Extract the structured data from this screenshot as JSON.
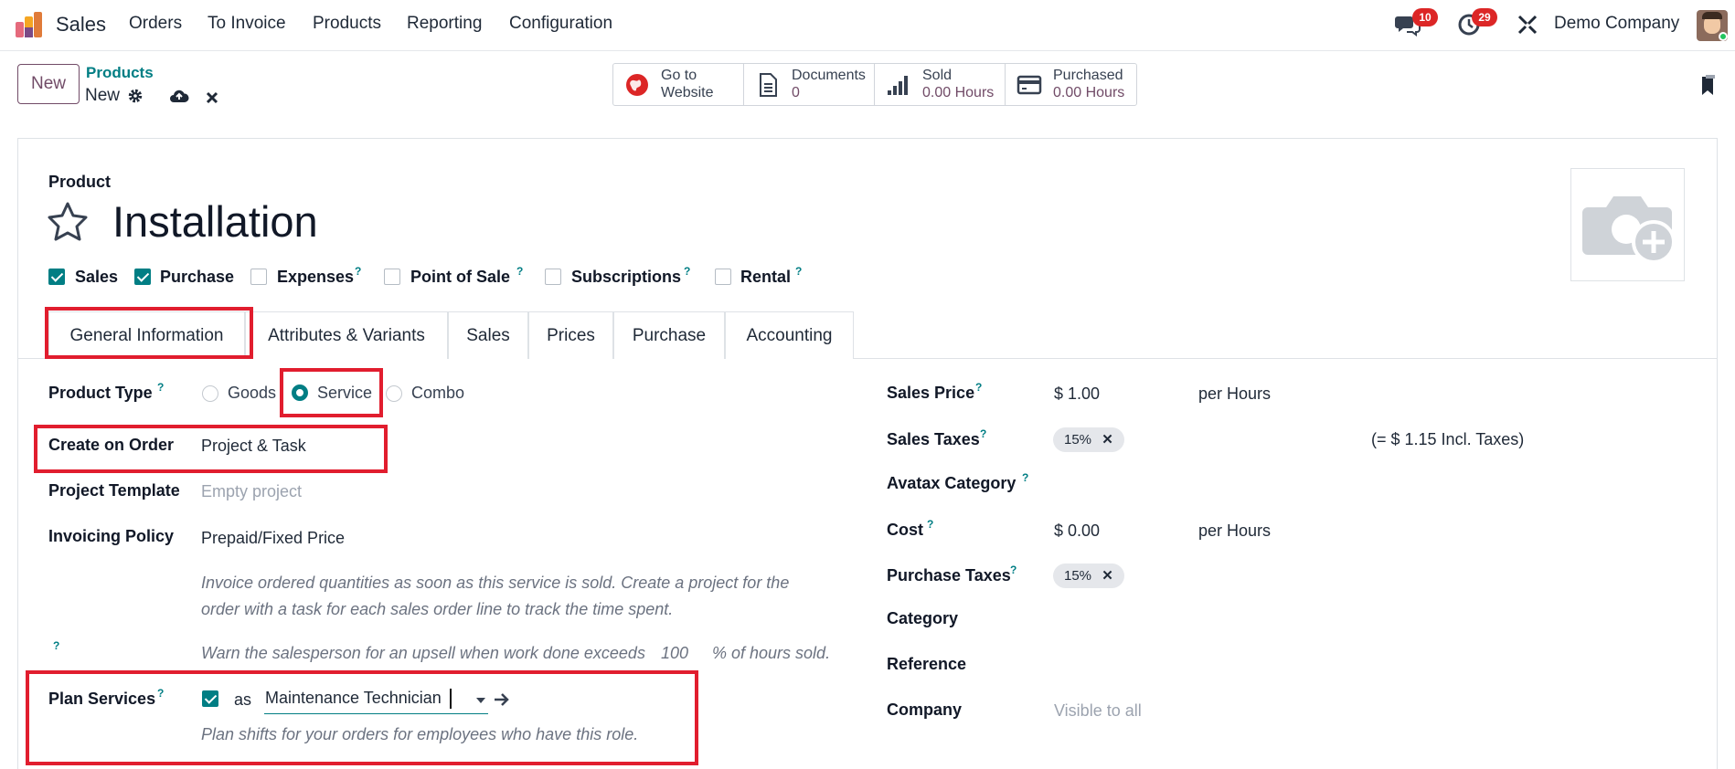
{
  "navbar": {
    "app_name": "Sales",
    "menu": [
      "Orders",
      "To Invoice",
      "Products",
      "Reporting",
      "Configuration"
    ],
    "messages_count": "10",
    "activities_count": "29",
    "company": "Demo Company"
  },
  "control": {
    "new_label": "New",
    "breadcrumb_parent": "Products",
    "breadcrumb_current": "New"
  },
  "smart_buttons": [
    {
      "line1": "Go to",
      "line2": "Website",
      "icon": "globe-icon"
    },
    {
      "line1": "Documents",
      "line2": "0",
      "icon": "document-icon"
    },
    {
      "line1": "Sold",
      "line2": "0.00 Hours",
      "icon": "signal-icon"
    },
    {
      "line1": "Purchased",
      "line2": "0.00 Hours",
      "icon": "credit-card-icon"
    }
  ],
  "product": {
    "header_label": "Product",
    "name": "Installation",
    "flags": [
      {
        "label": "Sales",
        "checked": true,
        "help": false
      },
      {
        "label": "Purchase",
        "checked": true,
        "help": false
      },
      {
        "label": "Expenses",
        "checked": false,
        "help": true
      },
      {
        "label": "Point of Sale",
        "checked": false,
        "help": true
      },
      {
        "label": "Subscriptions",
        "checked": false,
        "help": true
      },
      {
        "label": "Rental",
        "checked": false,
        "help": true
      }
    ]
  },
  "tabs": [
    "General Information",
    "Attributes & Variants",
    "Sales",
    "Prices",
    "Purchase",
    "Accounting"
  ],
  "left": {
    "product_type_label": "Product Type",
    "product_type_options": [
      "Goods",
      "Service",
      "Combo"
    ],
    "product_type_selected": "Service",
    "create_on_order_label": "Create on Order",
    "create_on_order_value": "Project & Task",
    "project_template_label": "Project Template",
    "project_template_placeholder": "Empty project",
    "invoicing_policy_label": "Invoicing Policy",
    "invoicing_policy_value": "Prepaid/Fixed Price",
    "invoicing_note_line1": "Invoice ordered quantities as soon as this service is sold. Create a project for the",
    "invoicing_note_line2": "order with a task for each sales order line to track the time spent.",
    "upsell_before": "Warn the salesperson for an upsell when work done exceeds",
    "upsell_value": "100",
    "upsell_after": "% of hours sold.",
    "plan_services_label": "Plan Services",
    "plan_services_checked": true,
    "plan_as": "as",
    "plan_role": "Maintenance Technician",
    "plan_note": "Plan shifts for your orders for employees who have this role."
  },
  "right": {
    "sales_price_label": "Sales Price",
    "sales_price": "$ 1.00",
    "sales_price_uom": "per Hours",
    "sales_taxes_label": "Sales Taxes",
    "sales_tax_tag": "15%",
    "incl_taxes": "(= $ 1.15 Incl. Taxes)",
    "avatax_label": "Avatax Category",
    "cost_label": "Cost",
    "cost": "$ 0.00",
    "cost_uom": "per Hours",
    "purchase_taxes_label": "Purchase Taxes",
    "purchase_tax_tag": "15%",
    "category_label": "Category",
    "reference_label": "Reference",
    "company_label": "Company",
    "company_placeholder": "Visible to all"
  },
  "colors": {
    "brand": "#714b67",
    "teal": "#017e84",
    "highlight": "#e11d2e",
    "badge": "#dc2626"
  }
}
